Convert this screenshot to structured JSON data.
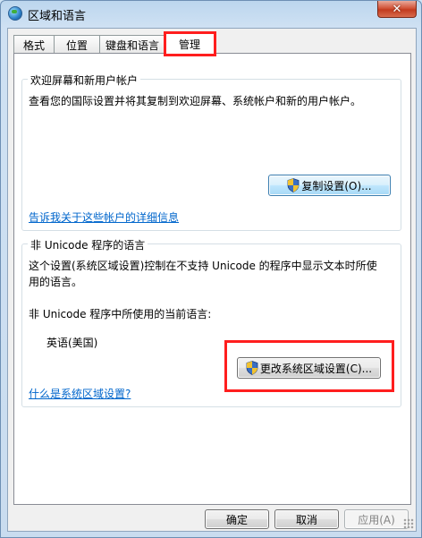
{
  "window": {
    "title": "区域和语言",
    "close_glyph": "✕"
  },
  "tabs": [
    {
      "label": "格式"
    },
    {
      "label": "位置"
    },
    {
      "label": "键盘和语言"
    },
    {
      "label": "管理",
      "active": true
    }
  ],
  "welcome_group": {
    "title": "欢迎屏幕和新用户帐户",
    "description": "查看您的国际设置并将其复制到欢迎屏幕、系统帐户和新的用户帐户。",
    "copy_button": "复制设置(O)...",
    "info_link": "告诉我关于这些帐户的详细信息"
  },
  "unicode_group": {
    "title": "非 Unicode 程序的语言",
    "description_line1": "这个设置(系统区域设置)控制在不支持 Unicode 的程序中显示文本时所使",
    "description_line2": "用的语言。",
    "current_label": "非 Unicode 程序中所使用的当前语言:",
    "current_value": "英语(美国)",
    "change_button": "更改系统区域设置(C)...",
    "help_link": "什么是系统区域设置?"
  },
  "footer": {
    "ok": "确定",
    "cancel": "取消",
    "apply": "应用(A)"
  },
  "colors": {
    "highlight": "#ff1e1e",
    "link": "#0066cc"
  },
  "icons": {
    "window": "globe-icon",
    "uac": "uac-shield-icon"
  }
}
